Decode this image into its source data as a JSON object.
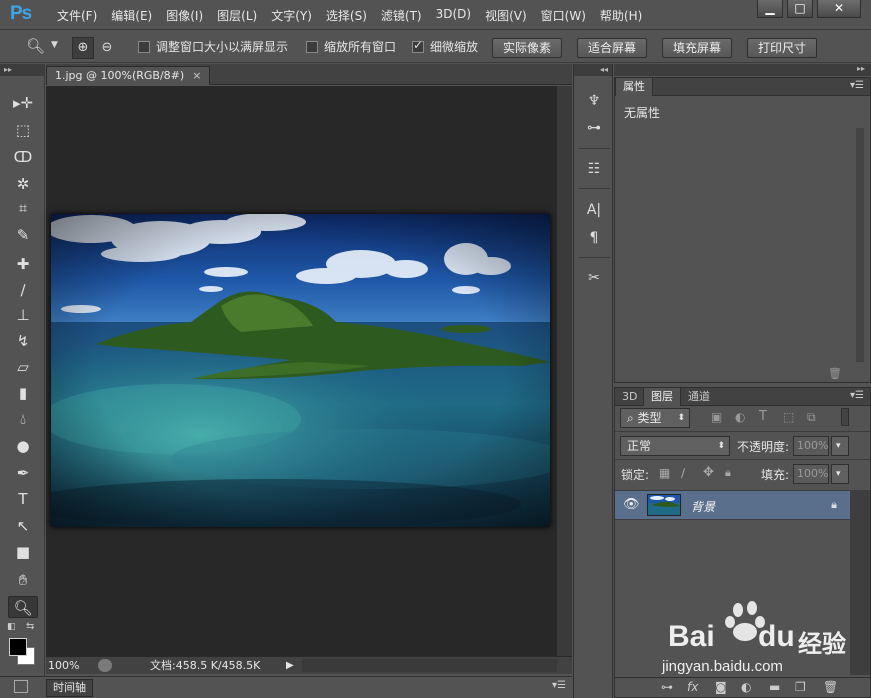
{
  "app": {
    "logo": "Ps",
    "menu": [
      "文件(F)",
      "编辑(E)",
      "图像(I)",
      "图层(L)",
      "文字(Y)",
      "选择(S)",
      "滤镜(T)",
      "3D(D)",
      "视图(V)",
      "窗口(W)",
      "帮助(H)"
    ]
  },
  "options": {
    "resize_windows": "调整窗口大小以满屏显示",
    "zoom_all": "缩放所有窗口",
    "scrubby_zoom": "细微缩放",
    "btn_actual": "实际像素",
    "btn_fit": "适合屏幕",
    "btn_fill": "填充屏幕",
    "btn_print": "打印尺寸",
    "resize_checked": false,
    "zoom_all_checked": false,
    "scrubby_checked": true
  },
  "document": {
    "tab_title": "1.jpg @ 100%(RGB/8#)",
    "tab_close": "×",
    "zoom": "100%",
    "doc_info": "文档:458.5 K/458.5K",
    "arrow": "▶"
  },
  "timeline": {
    "tab": "时间轴"
  },
  "properties": {
    "tab": "属性",
    "content": "无属性"
  },
  "layers": {
    "tabs": [
      "3D",
      "图层",
      "通道"
    ],
    "filter_label": "类型",
    "blend_mode": "正常",
    "opacity_label": "不透明度:",
    "opacity_value": "100%",
    "lock_label": "锁定:",
    "fill_label": "填充:",
    "fill_value": "100%",
    "layer_name": "背景"
  },
  "watermark": {
    "brand": "Bai",
    "brand2": "du",
    "cn": "经验",
    "url": "jingyan.baidu.com"
  },
  "colors": {
    "accent_logo": "#3fa3e8",
    "selected_layer": "#5a6f8c",
    "canvas_bg": "#282828",
    "ui_bg": "#535353"
  }
}
